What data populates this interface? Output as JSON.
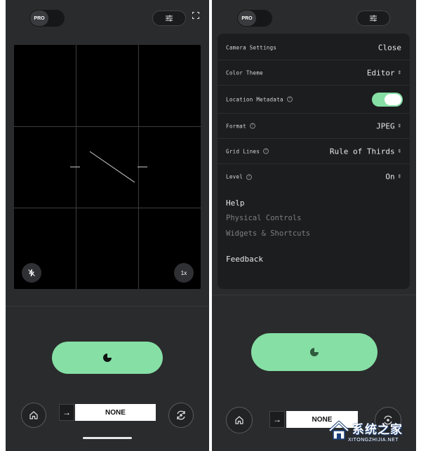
{
  "left_screen": {
    "pro_label": "PRO",
    "zoom_label": "1x",
    "filter_value": "NONE",
    "arrow_glyph": "→",
    "icons": [
      "settings-sliders-icon",
      "fullscreen-icon",
      "flash-off-icon",
      "shutter-icon",
      "home-icon",
      "switch-camera-icon"
    ]
  },
  "right_screen": {
    "pro_label": "PRO",
    "arrow_glyph": "→",
    "filter_value": "NONE",
    "settings": {
      "title": "Camera Settings",
      "close_label": "Close",
      "rows": [
        {
          "label": "Color Theme",
          "value": "Editor",
          "help": false
        },
        {
          "label": "Location Metadata",
          "value": "",
          "help": true,
          "toggle": true
        },
        {
          "label": "Format",
          "value": "JPEG",
          "help": true
        },
        {
          "label": "Grid Lines",
          "value": "Rule of Thirds",
          "help": true
        },
        {
          "label": "Level",
          "value": "On",
          "help": true
        }
      ],
      "help_heading": "Help",
      "help_links": [
        "Physical Controls",
        "Widgets & Shortcuts"
      ],
      "feedback_label": "Feedback"
    }
  },
  "watermark": {
    "brand": "系统之家",
    "url": "XITONGZHIJIA.NET"
  },
  "colors": {
    "accent": "#86dfa5",
    "phone_bg": "#2a2b2d",
    "panel_bg": "#1c1d1f"
  }
}
